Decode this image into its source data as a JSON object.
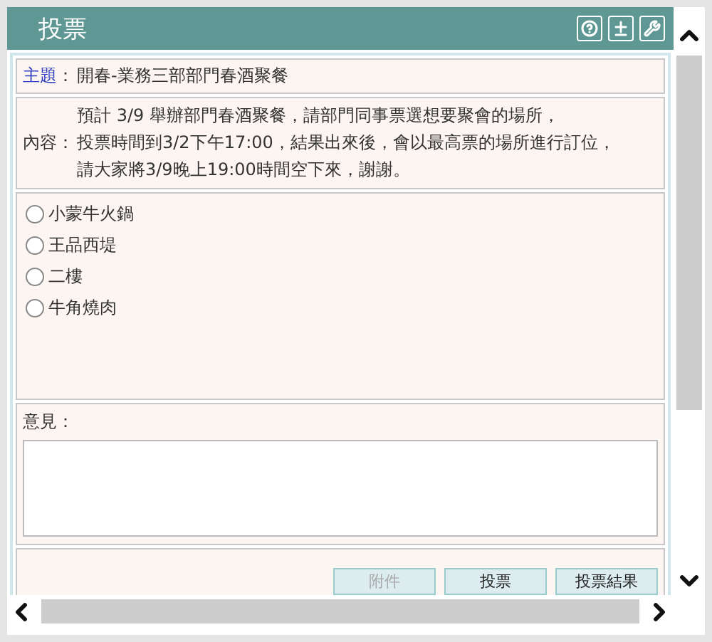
{
  "window": {
    "title": "投票"
  },
  "subject": {
    "label": "主題",
    "separator": "：",
    "value": "開春-業務三部部門春酒聚餐"
  },
  "content": {
    "label": "內容",
    "separator": "：",
    "lines": [
      "預計 3/9 舉辦部門春酒聚餐，請部門同事票選想要聚會的場所，",
      "投票時間到3/2下午17:00，結果出來後，會以最高票的場所進行訂位，",
      "請大家將3/9晚上19:00時間空下來，謝謝。"
    ]
  },
  "options": [
    {
      "label": "小蒙牛火鍋",
      "selected": false
    },
    {
      "label": "王品西堤",
      "selected": false
    },
    {
      "label": "二樓",
      "selected": false
    },
    {
      "label": "牛角燒肉",
      "selected": false
    }
  ],
  "comment": {
    "label": "意見："
  },
  "buttons": [
    {
      "label": "附件",
      "disabled": true
    },
    {
      "label": "投票",
      "disabled": false
    },
    {
      "label": "投票結果",
      "disabled": false
    }
  ]
}
